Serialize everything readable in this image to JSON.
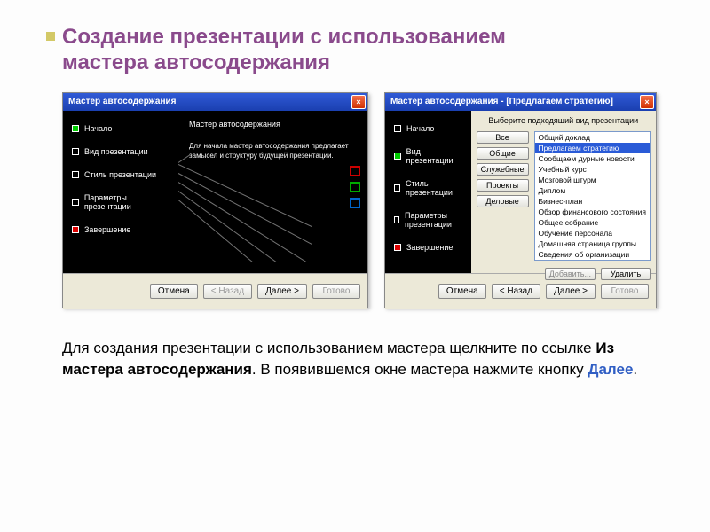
{
  "title_line1": "Создание презентации с использованием",
  "title_line2": "мастера автосодержания",
  "win1": {
    "title": "Мастер автосодержания",
    "nav": [
      "Начало",
      "Вид презентации",
      "Стиль презентации",
      "Параметры презентации",
      "Завершение"
    ],
    "panel_title": "Мастер автосодержания",
    "panel_text": "Для начала мастер автосодержания предлагает замысел и структуру будущей презентации.",
    "buttons": {
      "cancel": "Отмена",
      "back": "< Назад",
      "next": "Далее >",
      "finish": "Готово"
    }
  },
  "win2": {
    "title": "Мастер автосодержания - [Предлагаем стратегию]",
    "prompt": "Выберите подходящий вид презентации",
    "categories": [
      "Все",
      "Общие",
      "Служебные",
      "Проекты",
      "Деловые"
    ],
    "list": [
      "Общий доклад",
      "Предлагаем стратегию",
      "Сообщаем дурные новости",
      "Учебный курс",
      "Мозговой штурм",
      "Диплом",
      "Бизнес-план",
      "Обзор финансового состояния",
      "Общее собрание",
      "Обучение персонала",
      "Домашняя страница группы",
      "Сведения об организации"
    ],
    "selected_index": 1,
    "add": "Добавить...",
    "remove": "Удалить",
    "buttons": {
      "cancel": "Отмена",
      "back": "< Назад",
      "next": "Далее >",
      "finish": "Готово"
    }
  },
  "caption": {
    "p1a": "Для создания презентации с использованием мастера щелкните по ссылке ",
    "bold1": "Из мастера автосодержания",
    "p1b": ". В появившемся окне мастера нажмите кнопку ",
    "bold2": "Далее",
    "p1c": "."
  }
}
